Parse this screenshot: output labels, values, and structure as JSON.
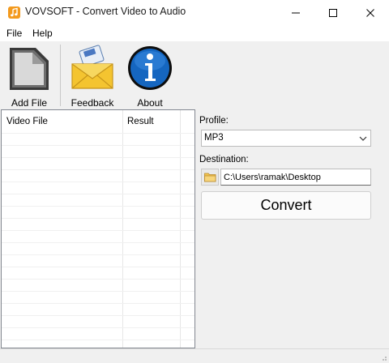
{
  "window": {
    "title": "VOVSOFT - Convert Video to Audio",
    "icon": "music-note-app-icon",
    "controls": [
      "minimize-icon",
      "maximize-icon",
      "close-icon"
    ]
  },
  "menu": {
    "items": [
      "File",
      "Help"
    ]
  },
  "toolbar": {
    "add_file": {
      "label": "Add File",
      "icon": "add-file-document-icon"
    },
    "feedback": {
      "label": "Feedback",
      "icon": "envelope-icon"
    },
    "about": {
      "label": "About",
      "icon": "info-icon"
    }
  },
  "file_list": {
    "columns": [
      "Video File",
      "Result"
    ],
    "rows": []
  },
  "profile": {
    "label": "Profile:",
    "selected": "MP3"
  },
  "destination": {
    "label": "Destination:",
    "path": "C:\\Users\\ramak\\Desktop",
    "icon": "folder-icon"
  },
  "convert": {
    "label": "Convert"
  },
  "colors": {
    "accent_orange": "#f39a1e",
    "info_blue": "#1566c0",
    "envelope_yellow": "#f4c430"
  }
}
